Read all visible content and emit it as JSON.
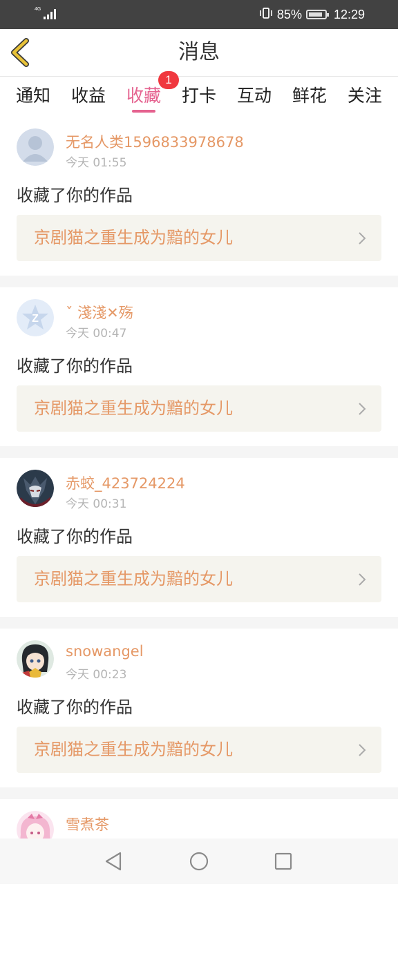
{
  "status_bar": {
    "network": "4G",
    "battery": "85%",
    "battery_level": 0.85,
    "time": "12:29",
    "icons": [
      "signal-icon",
      "vibrate-icon",
      "battery-icon"
    ]
  },
  "header": {
    "title": "消息",
    "back_icon": "chevron-left-icon"
  },
  "tabs": [
    {
      "label": "通知",
      "active": false
    },
    {
      "label": "收益",
      "active": false
    },
    {
      "label": "收藏",
      "active": true,
      "badge": "1"
    },
    {
      "label": "打卡",
      "active": false
    },
    {
      "label": "互动",
      "active": false
    },
    {
      "label": "鲜花",
      "active": false
    },
    {
      "label": "关注",
      "active": false
    }
  ],
  "notifications": [
    {
      "username": "无名人类1596833978678",
      "time": "今天 01:55",
      "action": "收藏了你的作品",
      "work": "京剧猫之重生成为黯的女儿",
      "avatar": "default-avatar"
    },
    {
      "username": "ˇ 淺淺✕殇",
      "time": "今天 00:47",
      "action": "收藏了你的作品",
      "work": "京剧猫之重生成为黯的女儿",
      "avatar": "z-logo-avatar"
    },
    {
      "username": "赤蛟_423724224",
      "time": "今天 00:31",
      "action": "收藏了你的作品",
      "work": "京剧猫之重生成为黯的女儿",
      "avatar": "character-avatar"
    },
    {
      "username": "snowangel",
      "time": "今天 00:23",
      "action": "收藏了你的作品",
      "work": "京剧猫之重生成为黯的女儿",
      "avatar": "anime-girl-avatar"
    },
    {
      "username": "雪煮茶",
      "time": "",
      "action": "",
      "work": "",
      "avatar": "pink-anime-avatar"
    }
  ],
  "colors": {
    "accent": "#e5628f",
    "username": "#e59866",
    "badge": "#f0383f",
    "status_bar": "#424242",
    "work_bg": "#f5f4ee",
    "back_icon": "#e8c238"
  },
  "nav_bar": {
    "icons": [
      "back-triangle-icon",
      "home-circle-icon",
      "recents-square-icon"
    ]
  }
}
